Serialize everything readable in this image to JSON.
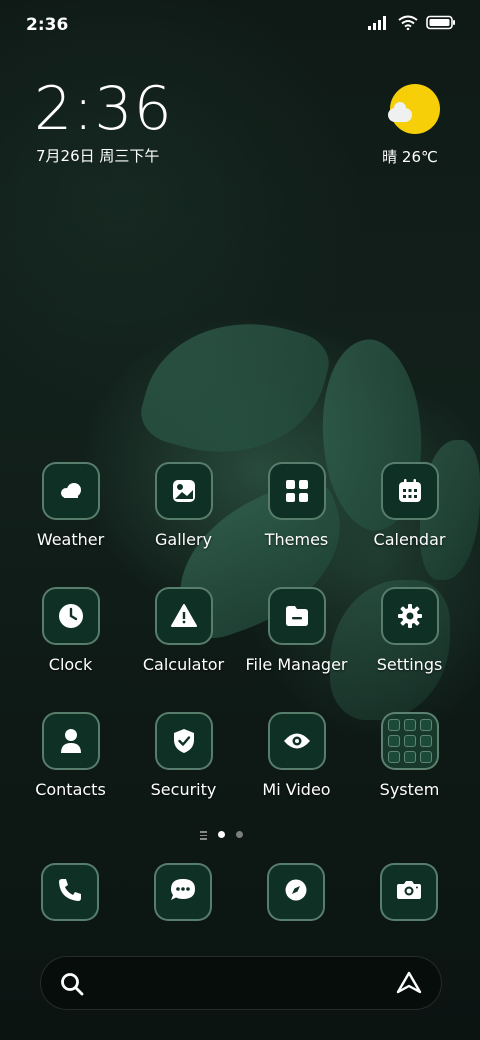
{
  "status": {
    "time": "2:36",
    "icons": [
      "signal-icon",
      "wifi-icon",
      "battery-icon"
    ]
  },
  "home": {
    "clock": "2:36",
    "date": "7月26日 周三下午",
    "weather": {
      "text": "晴 26℃",
      "icon": "sun-cloud-icon"
    }
  },
  "apps": [
    {
      "label": "Weather",
      "icon": "weather-icon"
    },
    {
      "label": "Gallery",
      "icon": "gallery-icon"
    },
    {
      "label": "Themes",
      "icon": "themes-icon"
    },
    {
      "label": "Calendar",
      "icon": "calendar-icon"
    },
    {
      "label": "Clock",
      "icon": "clock-icon"
    },
    {
      "label": "Calculator",
      "icon": "calculator-icon"
    },
    {
      "label": "File Manager",
      "icon": "file-manager-icon"
    },
    {
      "label": "Settings",
      "icon": "settings-icon"
    },
    {
      "label": "Contacts",
      "icon": "contacts-icon"
    },
    {
      "label": "Security",
      "icon": "security-icon"
    },
    {
      "label": "Mi Video",
      "icon": "mi-video-icon"
    },
    {
      "label": "System",
      "icon": "system-folder-icon"
    }
  ],
  "pager": {
    "pages": 2,
    "current": 1
  },
  "dock": [
    {
      "icon": "phone-icon"
    },
    {
      "icon": "messages-icon"
    },
    {
      "icon": "browser-icon"
    },
    {
      "icon": "camera-icon"
    }
  ],
  "search": {
    "placeholder": "",
    "left_icon": "search-icon",
    "right_icon": "assistant-icon"
  },
  "colors": {
    "accent": "#f6cf08",
    "icon_bg": "#0f3024",
    "icon_border": "#96beaa"
  }
}
